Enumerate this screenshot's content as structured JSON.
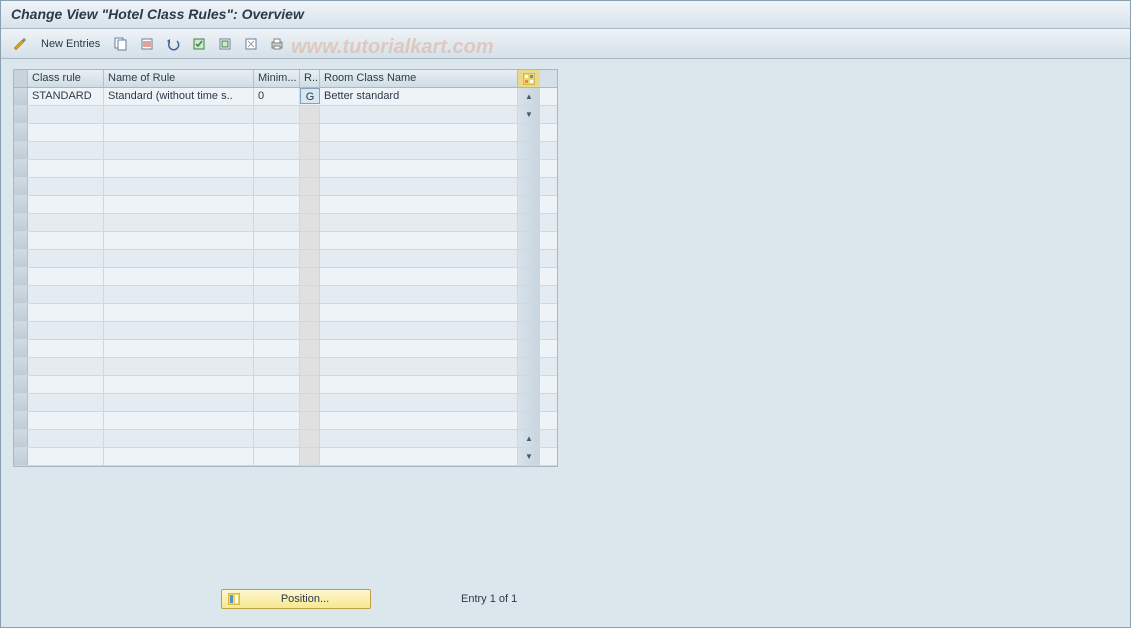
{
  "title": "Change View \"Hotel Class Rules\": Overview",
  "toolbar": {
    "new_entries": "New Entries"
  },
  "watermark": "www.tutorialkart.com",
  "grid": {
    "headers": {
      "class_rule": "Class rule",
      "name_of_rule": "Name of Rule",
      "minim": "Minim...",
      "r": "R..",
      "room_class_name": "Room Class Name"
    },
    "rows": [
      {
        "class_rule": "STANDARD",
        "name_of_rule": "Standard (without time s..",
        "minim": "0",
        "r": "G",
        "room_class_name": "Better standard"
      }
    ],
    "empty_rows": 20
  },
  "footer": {
    "position_button": "Position...",
    "entry_label": "Entry 1 of 1"
  }
}
